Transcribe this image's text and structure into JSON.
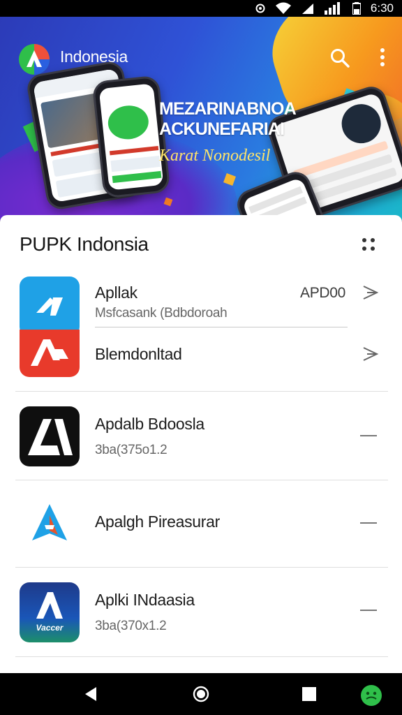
{
  "status_bar": {
    "time": "6:30"
  },
  "header": {
    "title": "Indonesia"
  },
  "hero": {
    "headline_line1": "MEZARINABNOA",
    "headline_line2": "ACKUNEFARIAI",
    "tagline": "Karat Nonodesil"
  },
  "section": {
    "title": "PUPK Indonsia"
  },
  "apps": [
    {
      "name": "Apllak",
      "subtitle": "Msfcasank (Bdbdoroah",
      "badge": "APD00",
      "icon": "blue-arrow-app-icon"
    },
    {
      "name": "Blemdonltad",
      "icon": "red-a-app-icon"
    },
    {
      "name": "Apdalb Bdoosla",
      "subtitle": "3ba(375o1.2",
      "icon": "black-a-app-icon"
    },
    {
      "name": "Apalgh Pireasurar",
      "icon": "blue-compass-a-icon"
    },
    {
      "name": "Aplki INdaasia",
      "subtitle": "3ba(370x1.2",
      "icon": "navy-a-app-icon",
      "icon_text": "Vaccer"
    }
  ],
  "colors": {
    "hero_blue": "#2f52d6",
    "accent_orange": "#f79a1e",
    "app_blue": "#1fa1e6",
    "app_red": "#e83a2b",
    "nav_green": "#2fbf4a"
  }
}
